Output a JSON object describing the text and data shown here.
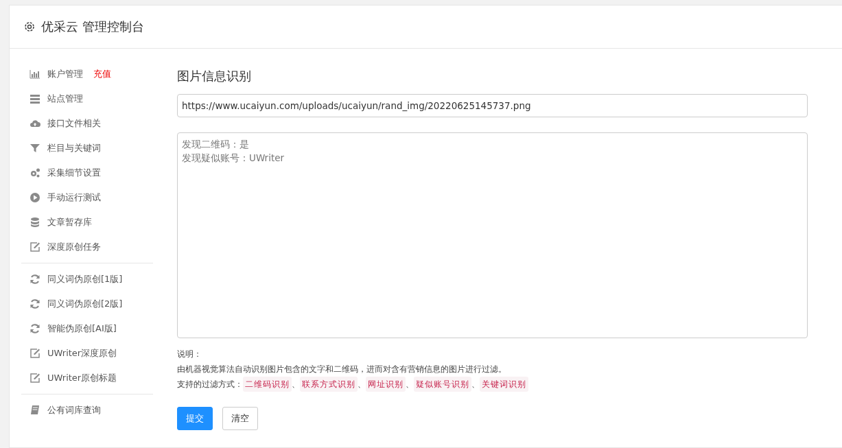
{
  "header": {
    "title": "优采云 管理控制台"
  },
  "sidebar": {
    "groups": [
      {
        "items": [
          {
            "label": "账户管理",
            "kind": "chart",
            "link": "充值"
          },
          {
            "label": "站点管理",
            "kind": "server"
          },
          {
            "label": "接口文件相关",
            "kind": "cloud"
          },
          {
            "label": "栏目与关键词",
            "kind": "filter"
          },
          {
            "label": "采集细节设置",
            "kind": "gears"
          },
          {
            "label": "手动运行测试",
            "kind": "play"
          },
          {
            "label": "文章暂存库",
            "kind": "database"
          },
          {
            "label": "深度原创任务",
            "kind": "edit"
          }
        ]
      },
      {
        "items": [
          {
            "label": "同义词伪原创[1版]",
            "kind": "refresh"
          },
          {
            "label": "同义词伪原创[2版]",
            "kind": "refresh"
          },
          {
            "label": "智能伪原创[AI版]",
            "kind": "refresh"
          },
          {
            "label": "UWriter深度原创",
            "kind": "edit"
          },
          {
            "label": "UWriter原创标题",
            "kind": "edit"
          }
        ]
      },
      {
        "items": [
          {
            "label": "公有词库查询",
            "kind": "book"
          }
        ]
      }
    ]
  },
  "main": {
    "title": "图片信息识别",
    "url_field": {
      "value": "https://www.ucaiyun.com/uploads/ucaiyun/rand_img/20220625145737.png"
    },
    "result_field": {
      "lines": [
        "发现二维码：是",
        "发现疑似账号：UWriter"
      ]
    },
    "notes": {
      "heading": "说明：",
      "description": "由机器视觉算法自动识别图片包含的文字和二维码，进而对含有营销信息的图片进行过滤。",
      "methods_label": "支持的过滤方式：",
      "methods": [
        "二维码识别",
        "联系方式识别",
        "网址识别",
        "疑似账号识别",
        "关键词识别"
      ],
      "separator": "、"
    },
    "buttons": [
      {
        "label": "提交",
        "kind": "primary"
      },
      {
        "label": "清空",
        "kind": "default"
      }
    ]
  }
}
